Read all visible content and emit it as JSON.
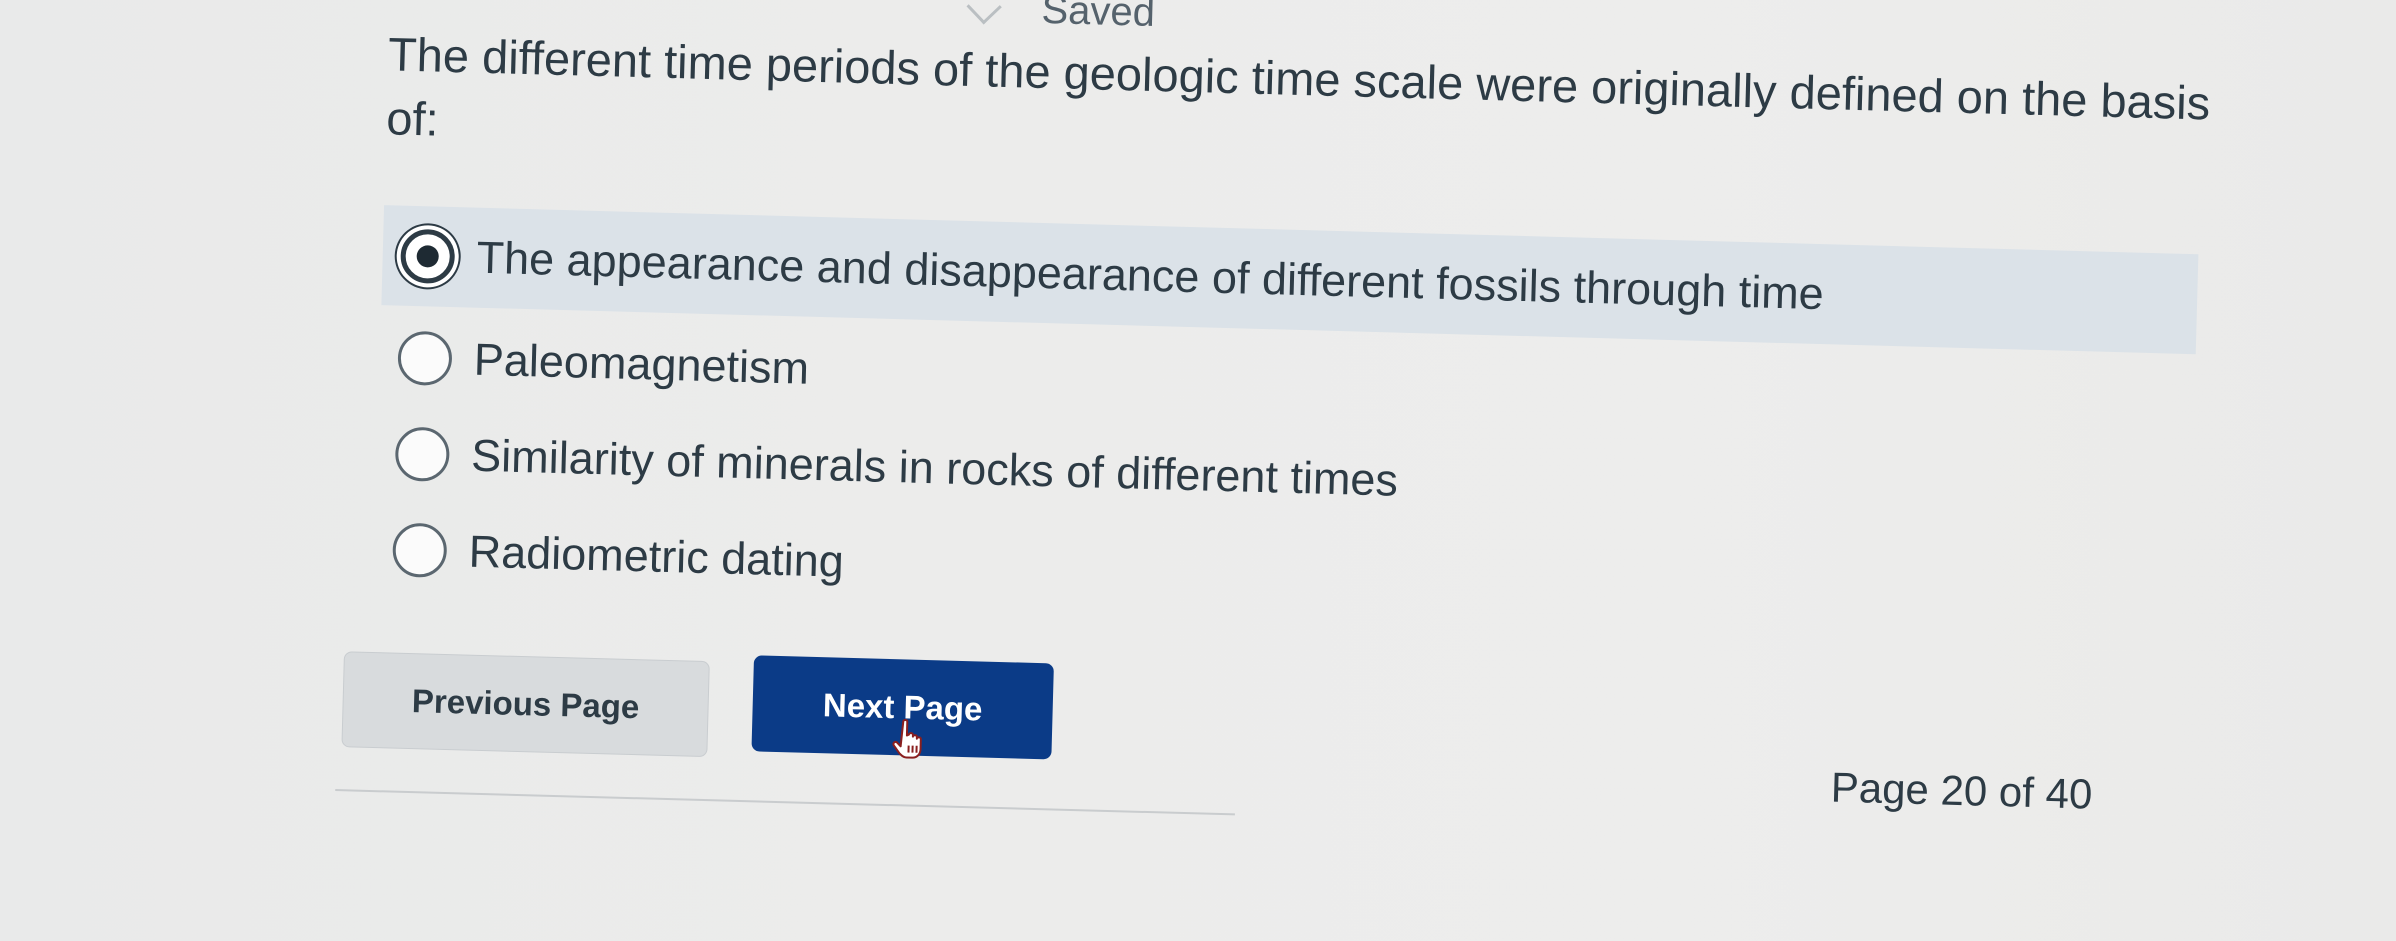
{
  "header": {
    "saved_label": "Saved"
  },
  "question": {
    "text": "The different time periods of the geologic time scale were originally defined on the basis of:"
  },
  "answers": [
    {
      "label": "The appearance and disappearance of different fossils through time",
      "selected": true
    },
    {
      "label": "Paleomagnetism",
      "selected": false
    },
    {
      "label": "Similarity of minerals in rocks of different times",
      "selected": false
    },
    {
      "label": "Radiometric dating",
      "selected": false
    }
  ],
  "navigation": {
    "previous_label": "Previous Page",
    "next_label": "Next Page",
    "page_indicator": "Page 20 of 40"
  },
  "colors": {
    "primary_button": "#0b3b87",
    "selected_answer_bg": "#dbe2e8",
    "text": "#2d3b45"
  },
  "icons": {
    "cursor": "hand-pointer-icon"
  }
}
